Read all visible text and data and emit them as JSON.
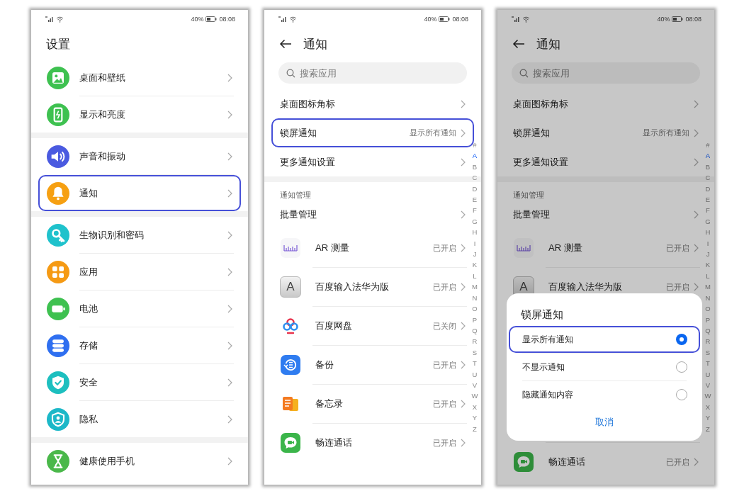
{
  "screens": [
    {
      "kind": "settings",
      "dimmed": false,
      "status": {
        "battery": "40%",
        "time": "08:08"
      },
      "title": "设置",
      "groups": [
        {
          "items": [
            {
              "kind": "image",
              "color": "#3ec150",
              "label": "桌面和壁纸",
              "highlighted": false
            },
            {
              "kind": "display",
              "color": "#3ec150",
              "label": "显示和亮度",
              "highlighted": false
            }
          ]
        },
        {
          "items": [
            {
              "kind": "sound",
              "color": "#4a5ae0",
              "label": "声音和振动",
              "highlighted": false
            },
            {
              "kind": "bell",
              "color": "#f6a012",
              "label": "通知",
              "highlighted": true
            }
          ]
        },
        {
          "items": [
            {
              "kind": "key",
              "color": "#1fc2cc",
              "label": "生物识别和密码",
              "highlighted": false
            },
            {
              "kind": "apps",
              "color": "#f59a14",
              "label": "应用",
              "highlighted": false
            },
            {
              "kind": "battery",
              "color": "#3ec150",
              "label": "电池",
              "highlighted": false
            },
            {
              "kind": "storage",
              "color": "#2f6ff0",
              "label": "存储",
              "highlighted": false
            },
            {
              "kind": "shield",
              "color": "#1dbfbf",
              "label": "安全",
              "highlighted": false
            },
            {
              "kind": "privacy",
              "color": "#1cb8c8",
              "label": "隐私",
              "highlighted": false
            }
          ]
        },
        {
          "items": [
            {
              "kind": "hourglass",
              "color": "#4ab84a",
              "label": "健康使用手机",
              "highlighted": false
            }
          ]
        }
      ]
    },
    {
      "kind": "notifications",
      "dimmed": false,
      "status": {
        "battery": "40%",
        "time": "08:08"
      },
      "title": "通知",
      "search": {
        "placeholder": "搜索应用"
      },
      "settings": [
        {
          "label": "桌面图标角标",
          "highlighted": false
        },
        {
          "label": "锁屏通知",
          "value": "显示所有通知",
          "highlighted": true
        },
        {
          "label": "更多通知设置",
          "highlighted": false
        }
      ],
      "section_header": "通知管理",
      "manage_row": "批量管理",
      "apps": [
        {
          "kind": "ruler",
          "name": "AR 测量",
          "status": "已开启"
        },
        {
          "kind": "keycap",
          "icon_text": "A",
          "name": "百度输入法华为版",
          "status": "已开启"
        },
        {
          "kind": "rings",
          "name": "百度网盘",
          "status": "已关闭"
        },
        {
          "kind": "backup",
          "name": "备份",
          "status": "已开启"
        },
        {
          "kind": "notes",
          "name": "备忘录",
          "status": "已开启"
        },
        {
          "kind": "chat",
          "name": "畅连通话",
          "status": "已开启"
        }
      ],
      "index": [
        {
          "letter": "#",
          "selected": false
        },
        {
          "letter": "A",
          "selected": true
        },
        {
          "letter": "B",
          "selected": false
        },
        {
          "letter": "C",
          "selected": false
        },
        {
          "letter": "D",
          "selected": false
        },
        {
          "letter": "E",
          "selected": false
        },
        {
          "letter": "F",
          "selected": false
        },
        {
          "letter": "G",
          "selected": false
        },
        {
          "letter": "H",
          "selected": false
        },
        {
          "letter": "I",
          "selected": false
        },
        {
          "letter": "J",
          "selected": false
        },
        {
          "letter": "K",
          "selected": false
        },
        {
          "letter": "L",
          "selected": false
        },
        {
          "letter": "M",
          "selected": false
        },
        {
          "letter": "N",
          "selected": false
        },
        {
          "letter": "O",
          "selected": false
        },
        {
          "letter": "P",
          "selected": false
        },
        {
          "letter": "Q",
          "selected": false
        },
        {
          "letter": "R",
          "selected": false
        },
        {
          "letter": "S",
          "selected": false
        },
        {
          "letter": "T",
          "selected": false
        },
        {
          "letter": "U",
          "selected": false
        },
        {
          "letter": "V",
          "selected": false
        },
        {
          "letter": "W",
          "selected": false
        },
        {
          "letter": "X",
          "selected": false
        },
        {
          "letter": "Y",
          "selected": false
        },
        {
          "letter": "Z",
          "selected": false
        }
      ]
    },
    {
      "kind": "notifications",
      "dimmed": true,
      "status": {
        "battery": "40%",
        "time": "08:08"
      },
      "title": "通知",
      "search": {
        "placeholder": "搜索应用"
      },
      "settings": [
        {
          "label": "桌面图标角标",
          "highlighted": false
        },
        {
          "label": "锁屏通知",
          "value": "显示所有通知",
          "highlighted": false
        },
        {
          "label": "更多通知设置",
          "highlighted": false
        }
      ],
      "section_header": "通知管理",
      "manage_row": "批量管理",
      "apps": [
        {
          "kind": "ruler",
          "name": "AR 测量",
          "status": "已开启"
        },
        {
          "kind": "keycap",
          "icon_text": "A",
          "name": "百度输入法华为版",
          "status": "已开启"
        }
      ],
      "dialog": {
        "title": "锁屏通知",
        "options": [
          {
            "label": "显示所有通知",
            "selected": true,
            "highlighted": true
          },
          {
            "label": "不显示通知",
            "selected": false,
            "highlighted": false
          },
          {
            "label": "隐藏通知内容",
            "selected": false,
            "highlighted": false
          }
        ],
        "cancel": "取消"
      },
      "apps_below_dialog": [
        {
          "kind": "chat",
          "name": "畅连通话",
          "status": "已开启"
        }
      ],
      "index": [
        {
          "letter": "#",
          "selected": false
        },
        {
          "letter": "A",
          "selected": true
        },
        {
          "letter": "B",
          "selected": false
        },
        {
          "letter": "C",
          "selected": false
        },
        {
          "letter": "D",
          "selected": false
        },
        {
          "letter": "E",
          "selected": false
        },
        {
          "letter": "F",
          "selected": false
        },
        {
          "letter": "G",
          "selected": false
        },
        {
          "letter": "H",
          "selected": false
        },
        {
          "letter": "I",
          "selected": false
        },
        {
          "letter": "J",
          "selected": false
        },
        {
          "letter": "K",
          "selected": false
        },
        {
          "letter": "L",
          "selected": false
        },
        {
          "letter": "M",
          "selected": false
        },
        {
          "letter": "N",
          "selected": false
        },
        {
          "letter": "O",
          "selected": false
        },
        {
          "letter": "P",
          "selected": false
        },
        {
          "letter": "Q",
          "selected": false
        },
        {
          "letter": "R",
          "selected": false
        },
        {
          "letter": "S",
          "selected": false
        },
        {
          "letter": "T",
          "selected": false
        },
        {
          "letter": "U",
          "selected": false
        },
        {
          "letter": "V",
          "selected": false
        },
        {
          "letter": "W",
          "selected": false
        },
        {
          "letter": "X",
          "selected": false
        },
        {
          "letter": "Y",
          "selected": false
        },
        {
          "letter": "Z",
          "selected": false
        }
      ]
    }
  ]
}
